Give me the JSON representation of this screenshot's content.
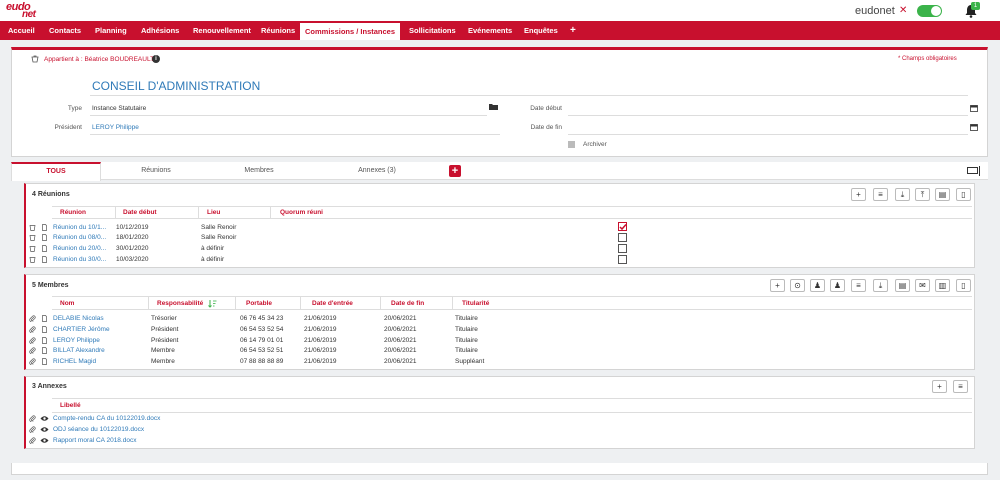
{
  "header": {
    "logo_line1": "eudo",
    "logo_line2": "net",
    "brand": "eudonet",
    "brand_mark": "✕",
    "notification_count": "1"
  },
  "nav": {
    "items": [
      "Accueil",
      "Contacts",
      "Planning",
      "Adhésions",
      "Renouvellement",
      "Réunions",
      "Commissions / Instances",
      "Sollicitations",
      "Evénements",
      "Enquêtes",
      "+"
    ],
    "active": "Commissions / Instances"
  },
  "record": {
    "owner": "Appartient à : Béatrice BOUDREAULT",
    "required_note": "* Champs obligatoires",
    "title": "CONSEIL D'ADMINISTRATION",
    "type_label": "Type",
    "type_value": "Instance Statutaire",
    "president_label": "Président",
    "president_value": "LEROY Philippe",
    "date_debut_label": "Date début",
    "date_debut_value": "",
    "date_fin_label": "Date de fin",
    "date_fin_value": "",
    "archiver_label": "Archiver"
  },
  "tabs": [
    "TOUS",
    "Réunions",
    "Membres",
    "Annexes (3)"
  ],
  "reunions": {
    "title": "4 Réunions",
    "columns": [
      "Réunion",
      "Date début",
      "Lieu",
      "Quorum réuni"
    ],
    "rows": [
      {
        "name": "Réunion du 10/1...",
        "date": "10/12/2019",
        "lieu": "Salle Renoir",
        "quorum": true
      },
      {
        "name": "Réunion du 08/0...",
        "date": "18/01/2020",
        "lieu": "Salle Renoir",
        "quorum": false
      },
      {
        "name": "Réunion du 20/0...",
        "date": "30/01/2020",
        "lieu": "à définir",
        "quorum": false
      },
      {
        "name": "Réunion du 30/0...",
        "date": "10/03/2020",
        "lieu": "à définir",
        "quorum": false
      }
    ]
  },
  "membres": {
    "title": "5 Membres",
    "columns": [
      "Nom",
      "Responsabilité",
      "Portable",
      "Date d'entrée",
      "Date de fin",
      "Titularité"
    ],
    "rows": [
      {
        "nom": "DELABIE Nicolas",
        "resp": "Trésorier",
        "tel": "06 76 45 34 23",
        "entree": "21/06/2019",
        "fin": "20/06/2021",
        "titu": "Titulaire"
      },
      {
        "nom": "CHARTIER Jérôme",
        "resp": "Président",
        "tel": "06 54 53 52 54",
        "entree": "21/06/2019",
        "fin": "20/06/2021",
        "titu": "Titulaire"
      },
      {
        "nom": "LEROY Philippe",
        "resp": "Président",
        "tel": "06 14 79 01 01",
        "entree": "21/06/2019",
        "fin": "20/06/2021",
        "titu": "Titulaire"
      },
      {
        "nom": "BILLAT Alexandre",
        "resp": "Membre",
        "tel": "06 54 53 52 51",
        "entree": "21/06/2019",
        "fin": "20/06/2021",
        "titu": "Titulaire"
      },
      {
        "nom": "RICHEL Magid",
        "resp": "Membre",
        "tel": "07 88 88 88 89",
        "entree": "21/06/2019",
        "fin": "20/06/2021",
        "titu": "Suppléant"
      }
    ]
  },
  "annexes": {
    "title": "3 Annexes",
    "columns": [
      "Libellé"
    ],
    "rows": [
      "Compte-rendu CA du 10122019.docx",
      "ODJ séance du 10122019.docx",
      "Rapport moral CA 2018.docx"
    ]
  },
  "colors": {
    "accent": "#c8102e",
    "link": "#2f7ab8",
    "success": "#3bb34a"
  }
}
